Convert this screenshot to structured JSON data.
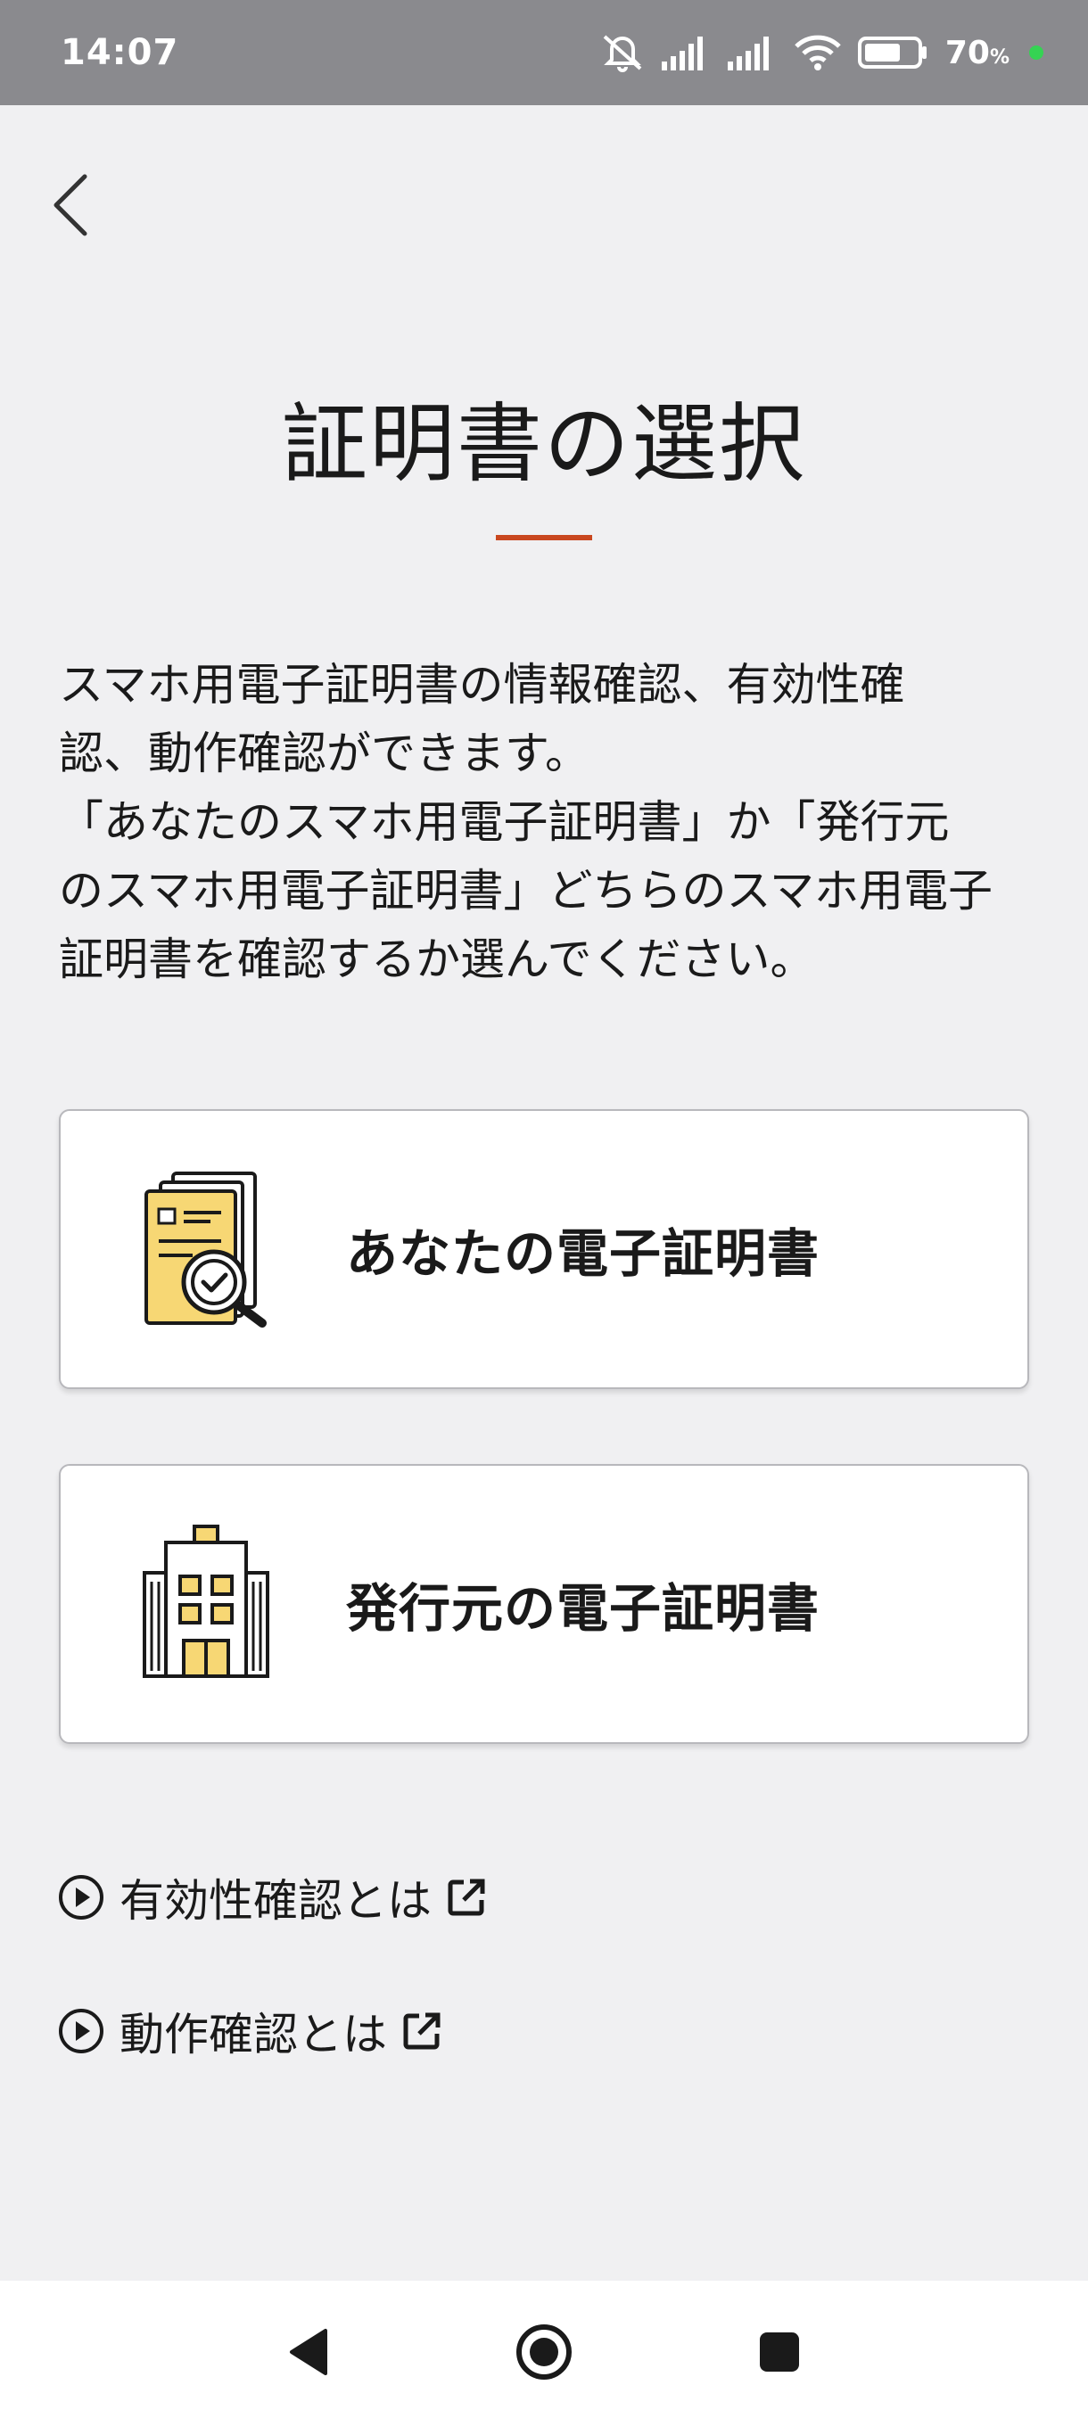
{
  "status_bar": {
    "time": "14:07",
    "battery_percent": "70",
    "battery_unit": "%",
    "battery_level": 0.7,
    "icons": [
      "mute-icon",
      "signal-icon",
      "signal-icon",
      "wifi-icon",
      "battery-icon"
    ]
  },
  "header": {
    "back_icon": "chevron-left-icon",
    "title": "証明書の選択",
    "accent_color": "#c9471f"
  },
  "description": {
    "lines": [
      "スマホ用電子証明書の情報確認、有効性確",
      "認、動作確認ができます。",
      "「あなたのスマホ用電子証明書」か「発行元",
      "のスマホ用電子証明書」どちらのスマホ用電子",
      "証明書を確認するか選んでください。"
    ]
  },
  "options": [
    {
      "label": "あなたの電子証明書",
      "icon": "certificate-search-icon"
    },
    {
      "label": "発行元の電子証明書",
      "icon": "building-icon"
    }
  ],
  "links": [
    {
      "label": "有効性確認とは",
      "icon": "play-circle-icon",
      "trailing_icon": "external-link-icon"
    },
    {
      "label": "動作確認とは",
      "icon": "play-circle-icon",
      "trailing_icon": "external-link-icon"
    }
  ],
  "icon_colors": {
    "yellow": "#f7d774",
    "stroke": "#1a1a1a"
  },
  "nav_bar": {
    "icons": [
      "nav-back-icon",
      "nav-home-icon",
      "nav-recent-icon"
    ]
  }
}
